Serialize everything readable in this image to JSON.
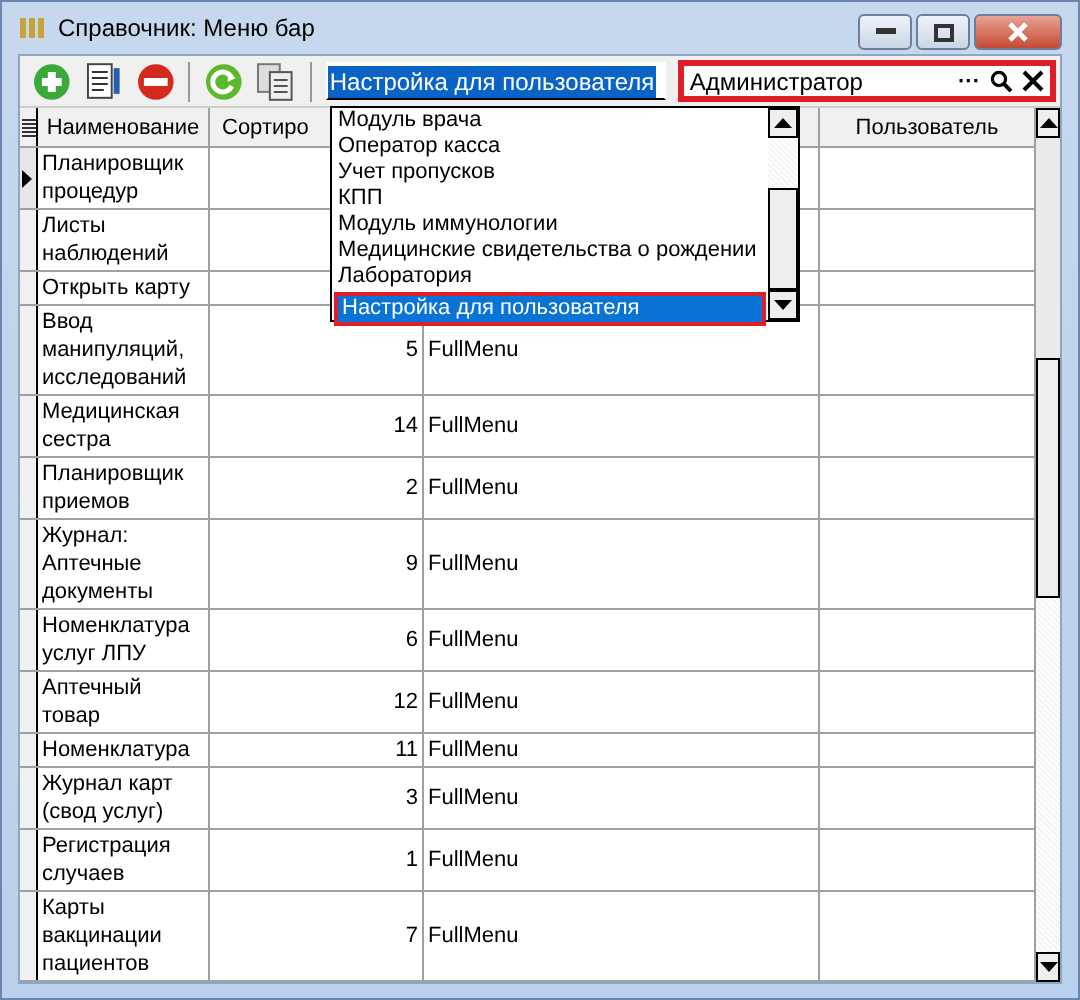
{
  "window": {
    "title": "Справочник: Меню бар"
  },
  "toolbar": {
    "combo": {
      "value": "Настройка для пользователя",
      "expanded": true
    },
    "lookup": {
      "value": "Администратор",
      "ellipsis": "···"
    }
  },
  "dropdown": {
    "items": [
      {
        "label": "Модуль врача",
        "selected": false
      },
      {
        "label": "Оператор касса",
        "selected": false
      },
      {
        "label": "Учет пропусков",
        "selected": false
      },
      {
        "label": "КПП",
        "selected": false
      },
      {
        "label": "Модуль иммунологии",
        "selected": false
      },
      {
        "label": "Медицинские свидетельства о рождении",
        "selected": false
      },
      {
        "label": "Лаборатория",
        "selected": false
      },
      {
        "label": "Настройка для пользователя",
        "selected": true
      }
    ]
  },
  "table": {
    "columns": [
      "Наименование",
      "Сортиро",
      "Пользователь"
    ],
    "rows": [
      {
        "name": "Планировщик процедур",
        "current": true
      },
      {
        "name": "Листы наблюдений",
        "current": false
      },
      {
        "name": "Открыть карту",
        "current": false
      },
      {
        "name": "Ввод манипуляций, исследований",
        "sort": "5",
        "menu": "FullMenu",
        "current": false
      },
      {
        "name": "Медицинская сестра",
        "sort": "14",
        "menu": "FullMenu",
        "current": false
      },
      {
        "name": "Планировщик приемов",
        "sort": "2",
        "menu": "FullMenu",
        "current": false
      },
      {
        "name": "Журнал: Аптечные документы",
        "sort": "9",
        "menu": "FullMenu",
        "current": false
      },
      {
        "name": "Номенклатура услуг ЛПУ",
        "sort": "6",
        "menu": "FullMenu",
        "current": false
      },
      {
        "name": "Аптечный товар",
        "sort": "12",
        "menu": "FullMenu",
        "current": false
      },
      {
        "name": "Номенклатура",
        "sort": "11",
        "menu": "FullMenu",
        "current": false
      },
      {
        "name": "Журнал карт (свод услуг)",
        "sort": "3",
        "menu": "FullMenu",
        "current": false
      },
      {
        "name": "Регистрация случаев",
        "sort": "1",
        "menu": "FullMenu",
        "current": false
      },
      {
        "name": "Карты вакцинации пациентов",
        "sort": "7",
        "menu": "FullMenu",
        "current": false
      }
    ]
  }
}
